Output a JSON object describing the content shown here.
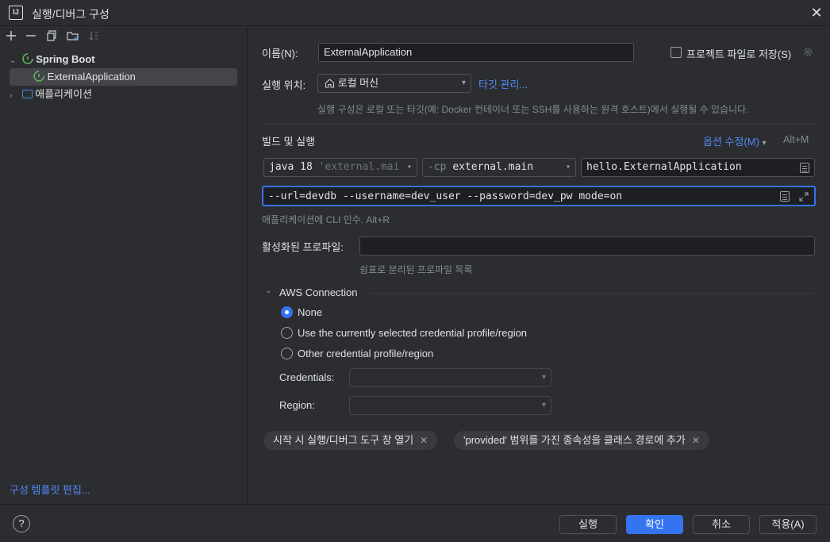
{
  "window": {
    "title": "실행/디버그 구성",
    "logo_text": "IJ",
    "close_glyph": "✕"
  },
  "left": {
    "toolbar_icons": [
      "plus-icon",
      "minus-icon",
      "copy-icon",
      "new-folder-icon",
      "sort-icon"
    ],
    "tree": {
      "spring_boot": "Spring Boot",
      "external_app": "ExternalApplication",
      "application": "애플리케이션"
    },
    "edit_templates": "구성 템플릿 편집..."
  },
  "form": {
    "name_label": "이름(N):",
    "name_value": "ExternalApplication",
    "store_as_project_file": "프로젝트 파일로 저장(S)",
    "run_on_label": "실행 위치:",
    "run_on_value": "로컬 머신",
    "manage_targets": "타깃 관리...",
    "run_on_hint": "실행 구성은 로컬 또는 타깃(예: Docker 컨테이너 또는 SSH를 사용하는 원격 호스트)에서 실행될 수 있습니다.",
    "build_run_label": "빌드 및 실행",
    "modify_options": "옵션 수정(M)",
    "modify_options_shortcut": "Alt+M",
    "jdk_value": "java 18",
    "jdk_module_hint": "'external.mai",
    "cp_prefix": "-cp",
    "cp_value": "external.main",
    "main_class": "hello.ExternalApplication",
    "program_args": "--url=devdb --username=dev_user --password=dev_pw mode=on",
    "program_args_hint": "애플리케이션에 CLI 인수. Alt+R",
    "active_profiles_label": "활성화된 프로파일:",
    "active_profiles_value": "",
    "active_profiles_hint": "쉼표로 분리된 프로파일 목록"
  },
  "aws": {
    "section_title": "AWS Connection",
    "options": [
      {
        "label": "None",
        "selected": true
      },
      {
        "label": "Use the currently selected credential profile/region",
        "selected": false
      },
      {
        "label": "Other credential profile/region",
        "selected": false
      }
    ],
    "credentials_label": "Credentials:",
    "credentials_value": "",
    "region_label": "Region:",
    "region_value": ""
  },
  "chips": [
    "시작 시 실행/디버그 도구 창 열기",
    "'provided' 범위를 가진 종속성을 클래스 경로에 추가"
  ],
  "buttons": {
    "help": "?",
    "run": "실행",
    "ok": "확인",
    "cancel": "취소",
    "apply": "적용(A)"
  },
  "colors": {
    "background": "#2b2d30",
    "accent": "#3574f0",
    "link": "#548af7",
    "spring_green": "#5fb85f"
  }
}
